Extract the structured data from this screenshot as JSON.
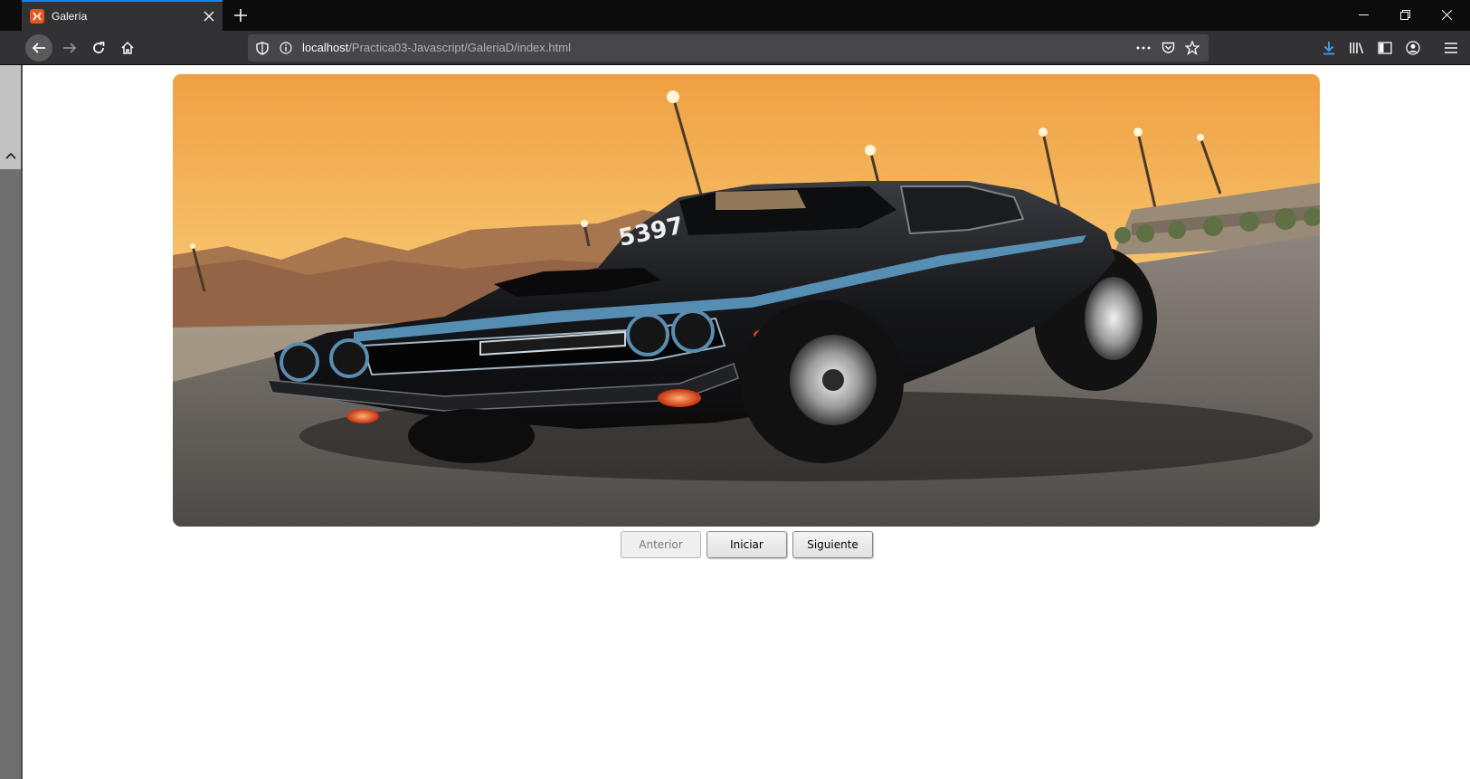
{
  "browser": {
    "tab": {
      "title": "Galería",
      "favicon": "xampp-icon"
    },
    "url": {
      "host": "localhost",
      "path": "/Practica03-Javascript/GaleriaD/index.html"
    },
    "colors": {
      "accent": "#0a84ff",
      "toolbar": "#323234",
      "tabstrip": "#0c0c0d"
    }
  },
  "gallery": {
    "image": {
      "icon": "car-photo",
      "description_colors": {
        "sky_top": "#f2a64a",
        "sky_bottom": "#f7cf7e",
        "car": "#17181b",
        "road": "#5e5b58"
      }
    },
    "buttons": {
      "previous": "Anterior",
      "start": "Iniciar",
      "next": "Siguiente"
    },
    "previous_disabled": true
  }
}
